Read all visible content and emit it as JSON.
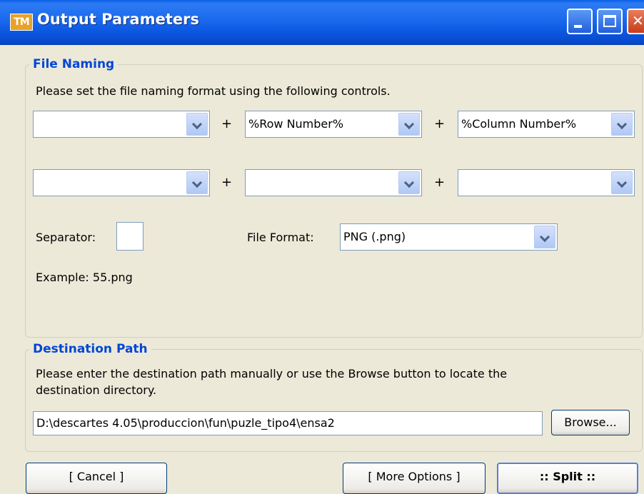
{
  "window": {
    "title": "Output Parameters",
    "app_icon_text": "TM"
  },
  "file_naming": {
    "legend": "File Naming",
    "instruction": "Please set the file naming format using the following controls.",
    "row1": [
      "",
      "%Row Number%",
      "%Column Number%"
    ],
    "row2": [
      "",
      "",
      ""
    ],
    "plus": "+",
    "separator_label": "Separator:",
    "separator_value": "",
    "file_format_label": "File Format:",
    "file_format_value": "PNG (.png)",
    "example": "Example: 55.png"
  },
  "destination": {
    "legend": "Destination Path",
    "instruction_line1": "Please enter the destination path manually or use the Browse button to locate the",
    "instruction_line2": "destination directory.",
    "path": "D:\\descartes 4.05\\produccion\\fun\\puzle_tipo4\\ensa2",
    "browse_label": "Browse..."
  },
  "buttons": {
    "cancel": "[ Cancel ]",
    "more_options": "[ More Options ]",
    "split": ":: Split ::"
  },
  "icons": [
    "app-icon",
    "minimize-icon",
    "maximize-icon",
    "close-icon",
    "chevron-down-icon"
  ],
  "colors": {
    "titlebar": "#0b55df",
    "legend": "#0046d5",
    "background": "#ece9d8"
  }
}
